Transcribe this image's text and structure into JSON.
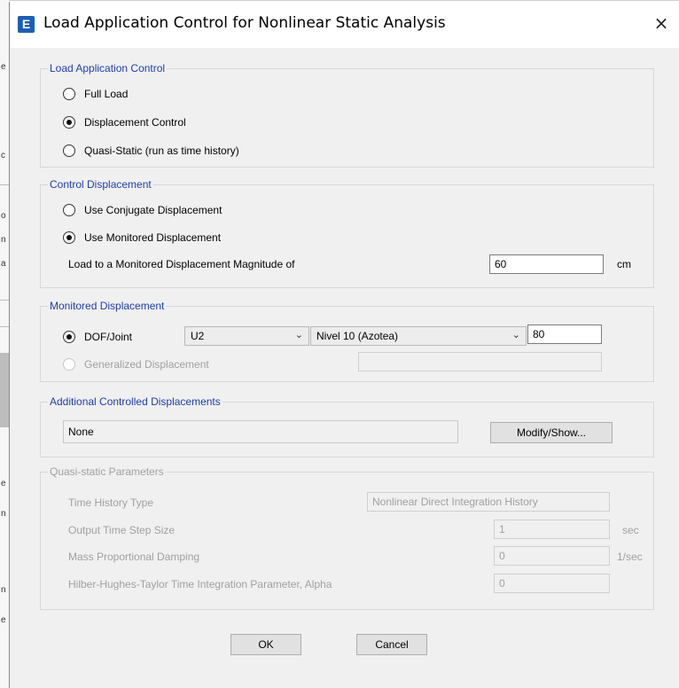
{
  "window": {
    "title": "Load Application Control for Nonlinear Static Analysis",
    "icon_letter": "E",
    "close_glyph": "×"
  },
  "load_application_control": {
    "legend": "Load Application Control",
    "options": [
      "Full Load",
      "Displacement Control",
      "Quasi-Static (run as time history)"
    ],
    "selected": "Displacement Control"
  },
  "control_displacement": {
    "legend": "Control Displacement",
    "options": [
      "Use Conjugate Displacement",
      "Use Monitored Displacement"
    ],
    "selected": "Use Monitored Displacement",
    "magnitude_label": "Load to a Monitored Displacement Magnitude of",
    "magnitude_value": "60",
    "magnitude_unit": "cm"
  },
  "monitored_displacement": {
    "legend": "Monitored Displacement",
    "dof_joint_label": "DOF/Joint",
    "dof_value": "U2",
    "story_value": "Nivel 10 (Azotea)",
    "joint_value": "80",
    "generalized_label": "Generalized Displacement",
    "generalized_value": "",
    "selected": "DOF/Joint"
  },
  "additional_controlled": {
    "legend": "Additional Controlled Displacements",
    "value": "None",
    "modify_button": "Modify/Show..."
  },
  "quasi_static": {
    "legend": "Quasi-static Parameters",
    "time_history_type_label": "Time History Type",
    "time_history_type_value": "Nonlinear Direct Integration History",
    "output_step_label": "Output Time Step Size",
    "output_step_value": "1",
    "output_step_unit": "sec",
    "mass_damping_label": "Mass Proportional Damping",
    "mass_damping_value": "0",
    "mass_damping_unit": "1/sec",
    "hht_label": "Hilber-Hughes-Taylor Time Integration Parameter, Alpha",
    "hht_value": "0"
  },
  "buttons": {
    "ok": "OK",
    "cancel": "Cancel"
  },
  "colors": {
    "group_legend": "#1f3fa8",
    "disabled_text": "#a0a0a0",
    "dialog_bg": "#f0f0f0",
    "icon_bg": "#1a5fb4"
  }
}
